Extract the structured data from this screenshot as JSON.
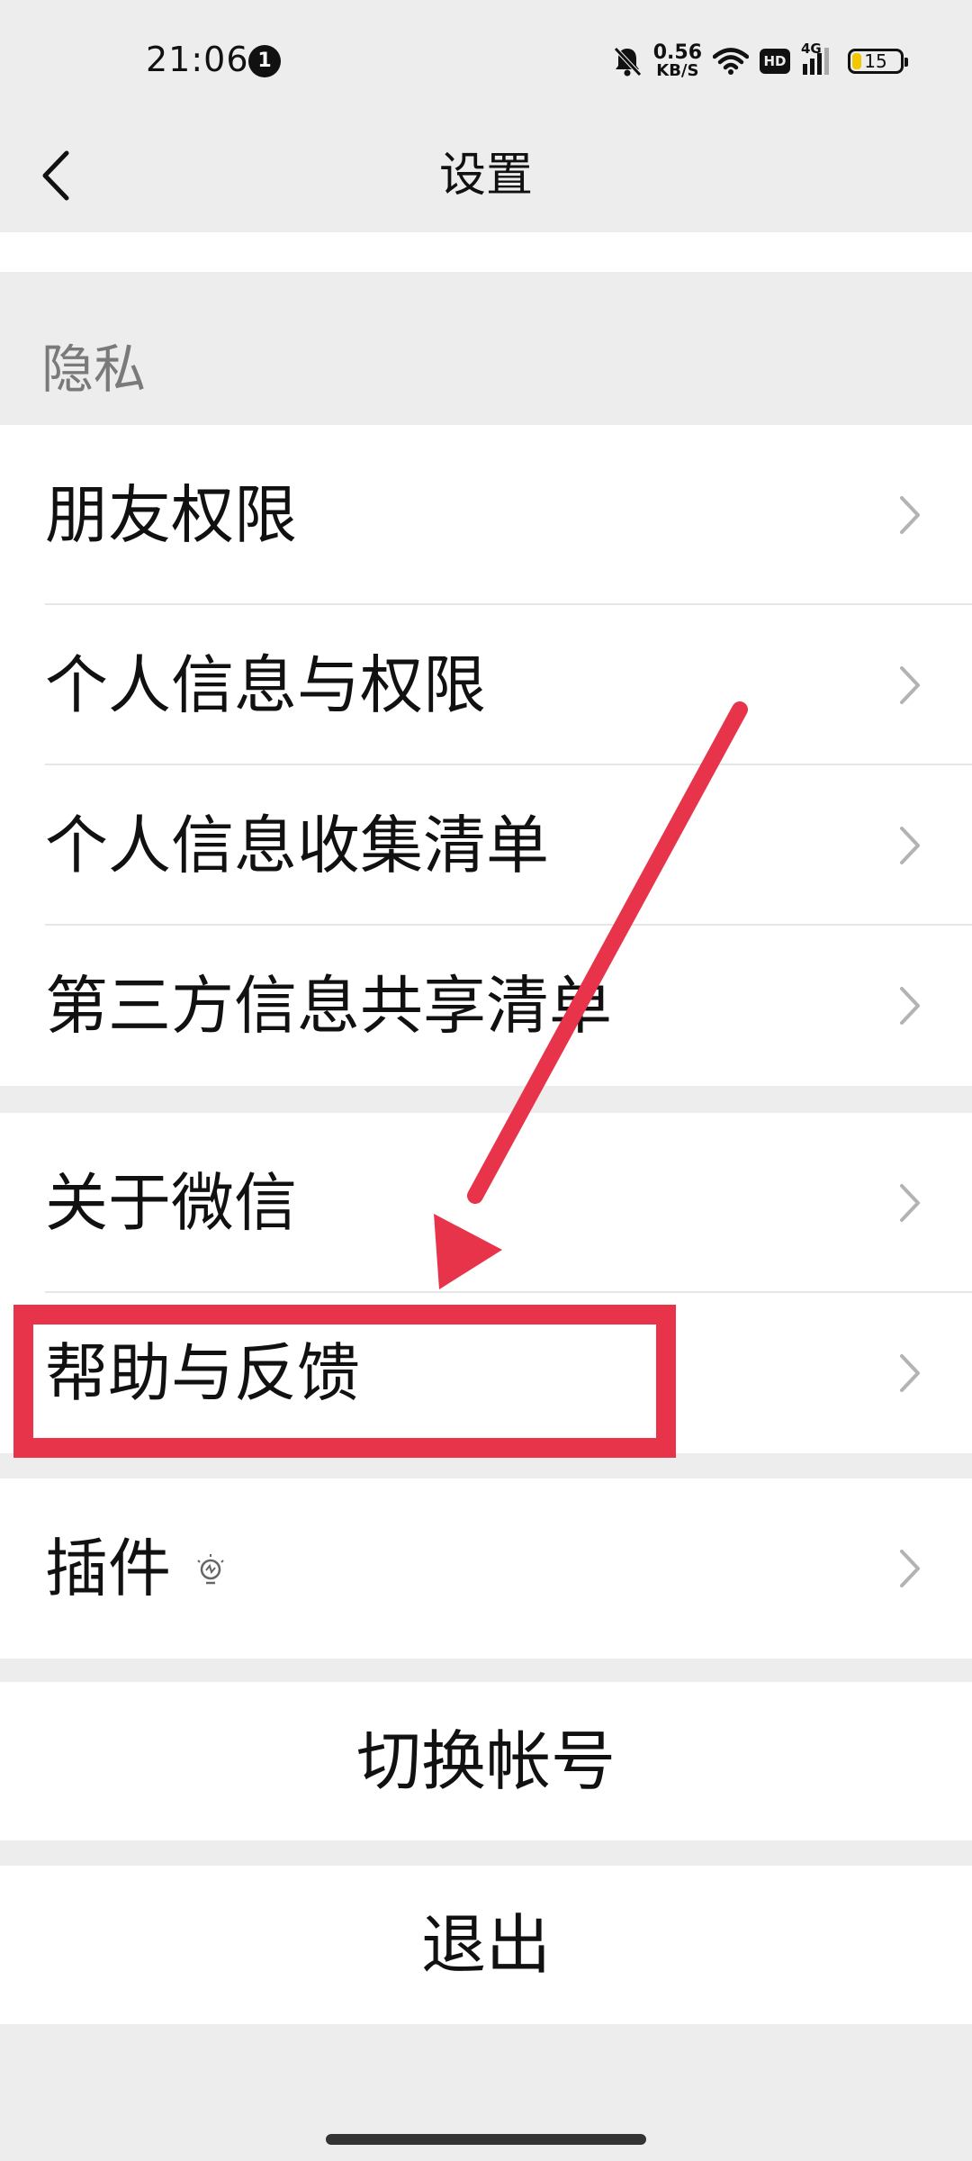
{
  "status_bar": {
    "time": "21:06",
    "notification_count": "1",
    "net_speed_value": "0.56",
    "net_speed_unit": "KB/S",
    "hd_label": "HD",
    "signal_label": "4G",
    "battery_level": "15"
  },
  "nav": {
    "title": "设置"
  },
  "privacy": {
    "section_label": "隐私",
    "items": [
      {
        "label": "朋友权限"
      },
      {
        "label": "个人信息与权限"
      },
      {
        "label": "个人信息收集清单"
      },
      {
        "label": "第三方信息共享清单"
      }
    ]
  },
  "about_group": {
    "items": [
      {
        "label": "关于微信"
      },
      {
        "label": "帮助与反馈"
      }
    ]
  },
  "plugins": {
    "label": "插件"
  },
  "switch_account": {
    "label": "切换帐号"
  },
  "logout": {
    "label": "退出"
  },
  "colors": {
    "background": "#ededed",
    "annotation_red": "#e8344a"
  }
}
